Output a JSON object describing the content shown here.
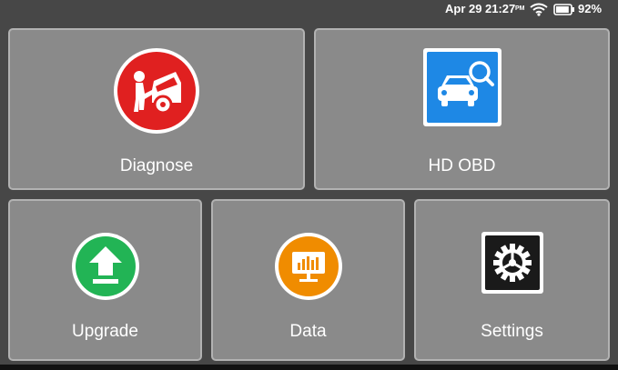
{
  "status_bar": {
    "date": "Apr 29",
    "time": "21:27",
    "ampm": "PM",
    "battery_percent": "92%",
    "battery_level": 0.92,
    "icons": [
      "wifi-icon",
      "battery-icon"
    ]
  },
  "tiles": [
    {
      "label": "Diagnose",
      "icon": "car-mechanic-icon",
      "icon_color": "#e02020"
    },
    {
      "label": "HD OBD",
      "icon": "car-search-icon",
      "icon_color": "#1e88e5"
    },
    {
      "label": "Upgrade",
      "icon": "upload-arrow-icon",
      "icon_color": "#22b455"
    },
    {
      "label": "Data",
      "icon": "monitor-chart-icon",
      "icon_color": "#f08c00"
    },
    {
      "label": "Settings",
      "icon": "gear-icon",
      "icon_color": "#1a1a1a"
    }
  ],
  "colors": {
    "background": "#474747",
    "tile": "#8a8a8a",
    "tile_border": "#b2b2b2",
    "text": "#ffffff"
  }
}
